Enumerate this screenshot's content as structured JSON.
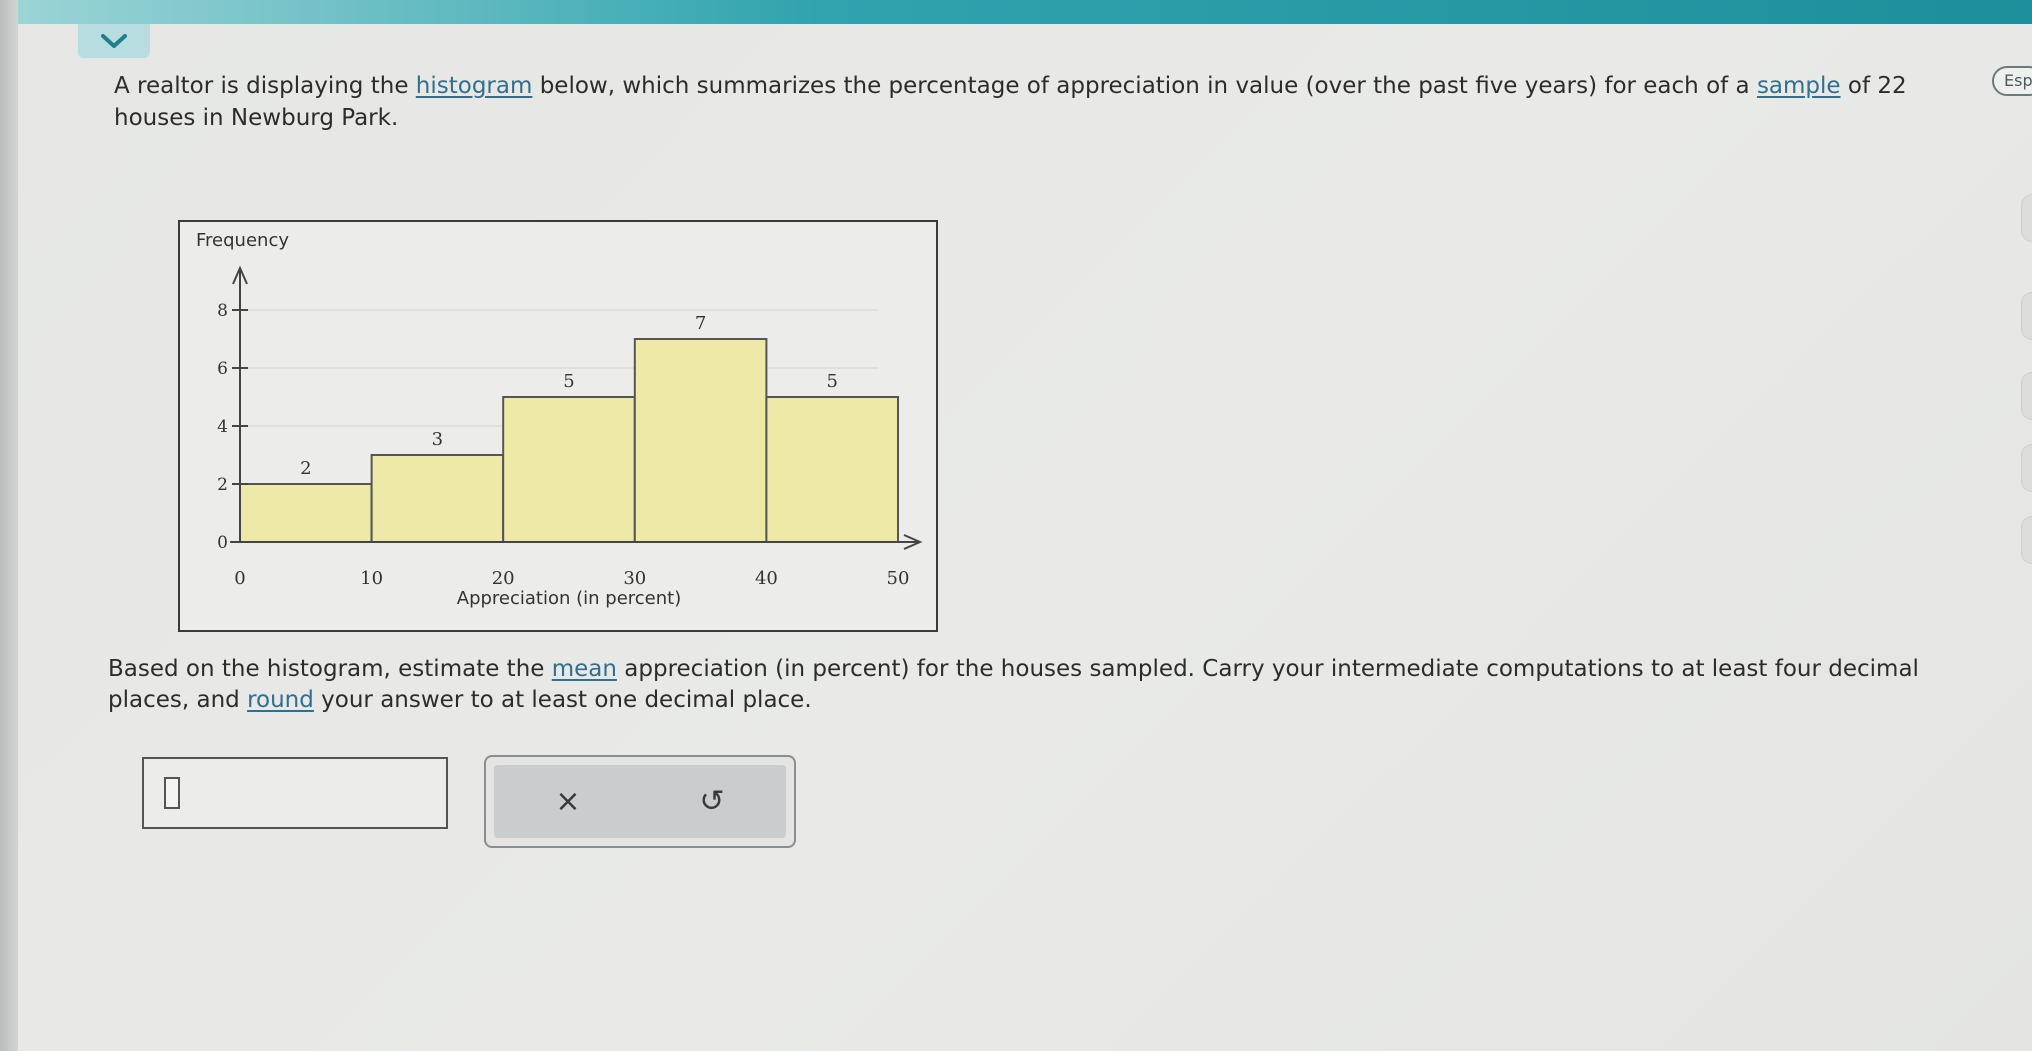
{
  "question": {
    "text_1": "A realtor is displaying the ",
    "link_histogram": "histogram",
    "text_2": " below, which summarizes the percentage of appreciation in value (over the past five years) for each of a ",
    "link_sample": "sample",
    "text_3": " of 22 houses in Newburg Park."
  },
  "prompt": {
    "text_1": "Based on the histogram, estimate the ",
    "link_mean": "mean",
    "text_2": " appreciation (in percent) for the houses sampled. Carry your intermediate computations to at least four decimal places, and ",
    "link_round": "round",
    "text_3": " your answer to at least one decimal place."
  },
  "language_button": {
    "label": "Espa"
  },
  "answer": {
    "value": ""
  },
  "actions": {
    "clear_label": "×",
    "undo_label": "↺"
  },
  "icons": {
    "collapse": "chevron-down-icon",
    "clear": "close-icon",
    "undo": "undo-icon"
  },
  "colors": {
    "bar_fill": "#efe9a8",
    "accent": "#1d8f9c",
    "link": "#2f6f8f"
  },
  "chart_data": {
    "type": "bar",
    "ylabel": "Frequency",
    "xlabel": "Appreciation (in percent)",
    "bins": [
      {
        "from": 0,
        "to": 10,
        "value": 2
      },
      {
        "from": 10,
        "to": 20,
        "value": 3
      },
      {
        "from": 20,
        "to": 30,
        "value": 5
      },
      {
        "from": 30,
        "to": 40,
        "value": 7
      },
      {
        "from": 40,
        "to": 50,
        "value": 5
      }
    ],
    "x_ticks": [
      "0",
      "10",
      "20",
      "30",
      "40",
      "50"
    ],
    "y_ticks": [
      "0",
      "2",
      "4",
      "6",
      "8"
    ],
    "xlim": [
      0,
      50
    ],
    "ylim": [
      0,
      8
    ],
    "grid": true
  }
}
